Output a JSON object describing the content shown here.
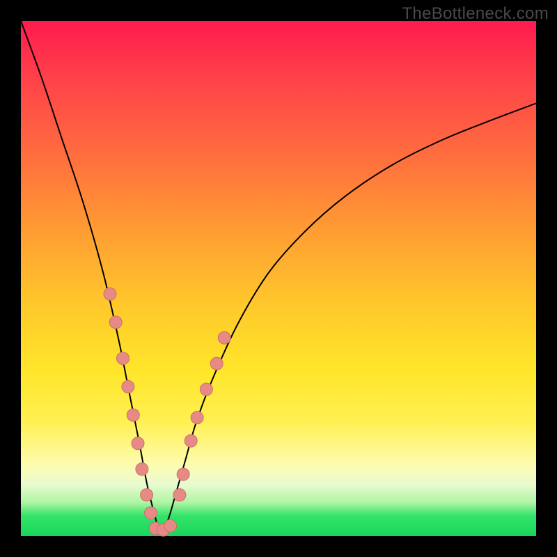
{
  "watermark": "TheBottleneck.com",
  "colors": {
    "frame": "#000000",
    "gradient_top": "#ff1a4f",
    "gradient_bottom": "#18d659",
    "curve": "#000000",
    "dot_fill": "#e78a86",
    "dot_stroke": "#c96f6b"
  },
  "chart_data": {
    "type": "line",
    "title": "",
    "xlabel": "",
    "ylabel": "",
    "xlim": [
      0,
      100
    ],
    "ylim": [
      0,
      100
    ],
    "grid": false,
    "series": [
      {
        "name": "bottleneck-curve",
        "description": "V-shaped bottleneck profile; minimum near x≈27 where the curve touches the green zone, rising steeply toward the top-left corner and asymptotically toward the upper right.",
        "x": [
          0,
          4,
          8,
          12,
          16,
          19,
          21,
          23,
          24.5,
          26,
          27,
          28.5,
          30,
          32,
          34,
          37,
          42,
          48,
          55,
          63,
          72,
          82,
          92,
          100
        ],
        "y": [
          100,
          89,
          77,
          65,
          51,
          38,
          28,
          18,
          10,
          4,
          0.8,
          3,
          8,
          15,
          22,
          30,
          41,
          51,
          59,
          66,
          72,
          77,
          81,
          84
        ]
      }
    ],
    "marker_points": {
      "description": "Highlighted sample points clustered near the curve minimum on both arms.",
      "points": [
        {
          "x": 17.3,
          "y": 47.0
        },
        {
          "x": 18.4,
          "y": 41.5
        },
        {
          "x": 19.8,
          "y": 34.5
        },
        {
          "x": 20.8,
          "y": 29.0
        },
        {
          "x": 21.8,
          "y": 23.5
        },
        {
          "x": 22.7,
          "y": 18.0
        },
        {
          "x": 23.5,
          "y": 13.0
        },
        {
          "x": 24.4,
          "y": 8.0
        },
        {
          "x": 25.2,
          "y": 4.5
        },
        {
          "x": 26.1,
          "y": 1.5
        },
        {
          "x": 27.6,
          "y": 1.2
        },
        {
          "x": 29.0,
          "y": 2.0
        },
        {
          "x": 30.8,
          "y": 8.0
        },
        {
          "x": 31.5,
          "y": 12.0
        },
        {
          "x": 33.0,
          "y": 18.5
        },
        {
          "x": 34.2,
          "y": 23.0
        },
        {
          "x": 36.0,
          "y": 28.5
        },
        {
          "x": 38.0,
          "y": 33.5
        },
        {
          "x": 39.5,
          "y": 38.5
        }
      ],
      "radius_px": 9
    }
  }
}
